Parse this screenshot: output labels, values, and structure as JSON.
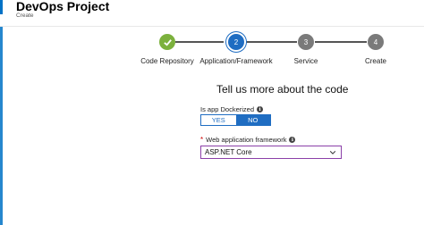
{
  "header": {
    "title": "DevOps Project",
    "subtitle": "Create"
  },
  "wizard": {
    "steps": [
      {
        "number": "",
        "label": "Code Repository",
        "state": "complete"
      },
      {
        "number": "2",
        "label": "Application/Framework",
        "state": "active"
      },
      {
        "number": "3",
        "label": "Service",
        "state": "pending"
      },
      {
        "number": "4",
        "label": "Create",
        "state": "pending"
      }
    ]
  },
  "form": {
    "section_title": "Tell us more about the code",
    "dockerized": {
      "label": "Is app Dockerized",
      "options": [
        "YES",
        "NO"
      ],
      "selected": "NO"
    },
    "framework": {
      "label": "Web application framework",
      "value": "ASP.NET Core"
    }
  },
  "colors": {
    "accent": "#0072c6",
    "active_step": "#1f6dc2",
    "complete_step": "#7cb13d",
    "pending_step": "#7a7a7a",
    "select_border": "#8b3fa8"
  }
}
